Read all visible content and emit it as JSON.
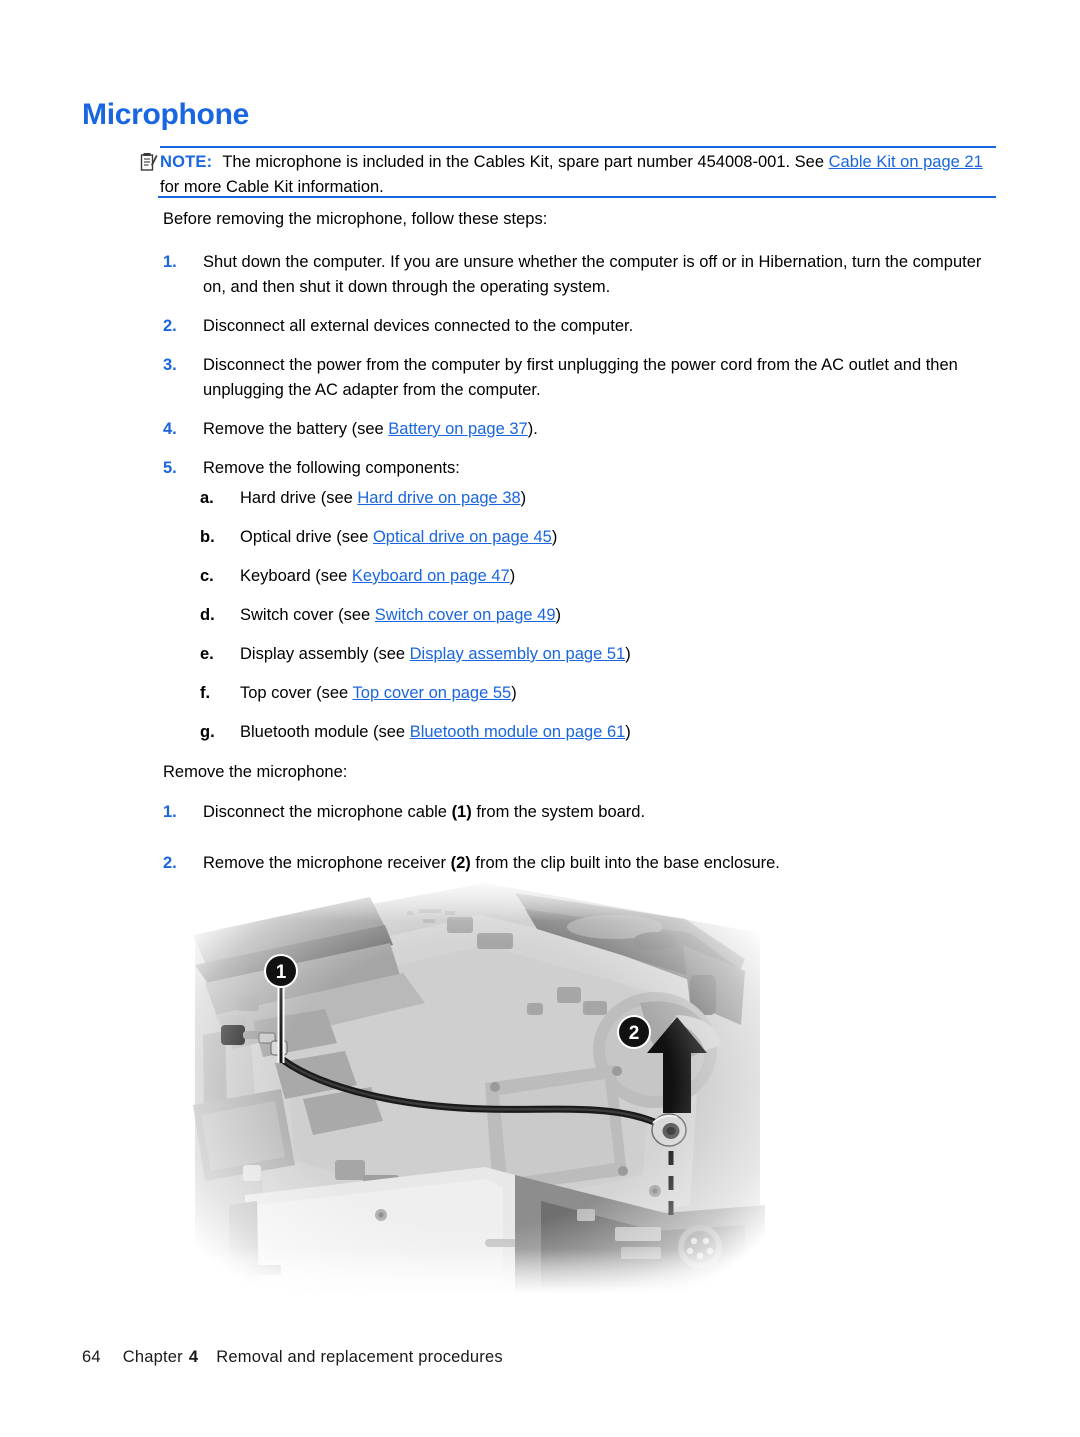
{
  "document": {
    "heading": "Microphone",
    "colors": {
      "accent_blue": "#1a66e0",
      "text_black": "#000000",
      "link_blue": "#1a66e0"
    }
  },
  "note": {
    "icon": "note-clipboard-icon",
    "label": "NOTE:",
    "text_before_link": "The microphone is included in the Cables Kit, spare part number 454008-001. See ",
    "link": "Cable Kit on page 21",
    "text_after_link": " for more Cable Kit information."
  },
  "intro_paragraph": "Before removing the microphone, follow these steps:",
  "steps": [
    {
      "marker": "1.",
      "text": "Shut down the computer. If you are unsure whether the computer is off or in Hibernation, turn the computer on, and then shut it down through the operating system."
    },
    {
      "marker": "2.",
      "text": "Disconnect all external devices connected to the computer."
    },
    {
      "marker": "3.",
      "text": "Disconnect the power from the computer by first unplugging the power cord from the AC outlet and then unplugging the AC adapter from the computer."
    },
    {
      "marker": "4.",
      "text_before_link": "Remove the battery (see ",
      "link": "Battery on page 37",
      "text_after_link": ")."
    },
    {
      "marker": "5.",
      "text": "Remove the following components:"
    }
  ],
  "substeps": [
    {
      "marker": "a.",
      "text_before_link": "Hard drive (see ",
      "link": "Hard drive on page 38",
      "text_after_link": ")"
    },
    {
      "marker": "b.",
      "text_before_link": "Optical drive (see ",
      "link": "Optical drive on page 45",
      "text_after_link": ")"
    },
    {
      "marker": "c.",
      "text_before_link": "Keyboard (see ",
      "link": "Keyboard on page 47",
      "text_after_link": ")"
    },
    {
      "marker": "d.",
      "text_before_link": "Switch cover (see ",
      "link": "Switch cover on page 49",
      "text_after_link": ")"
    },
    {
      "marker": "e.",
      "text_before_link": "Display assembly (see ",
      "link": "Display assembly on page 51",
      "text_after_link": ")"
    },
    {
      "marker": "f.",
      "text_before_link": "Top cover (see ",
      "link": "Top cover on page 55",
      "text_after_link": ")"
    },
    {
      "marker": "g.",
      "text_before_link": "Bluetooth module (see ",
      "link": "Bluetooth module on page 61",
      "text_after_link": ")"
    }
  ],
  "mid_paragraph": "Remove the microphone:",
  "removal_steps": [
    {
      "marker": "1.",
      "text_before_callout": "Disconnect the microphone cable ",
      "callout": "(1)",
      "text_after_callout": " from the system board."
    },
    {
      "marker": "2.",
      "text_before_callout": "Remove the microphone receiver ",
      "callout": "(2)",
      "text_after_callout": " from the clip built into the base enclosure."
    }
  ],
  "figure": {
    "description": "Grayscale photograph of laptop base enclosure showing microphone cable routing",
    "callouts": [
      {
        "number": "1",
        "meaning": "microphone cable connector on system board"
      },
      {
        "number": "2",
        "meaning": "microphone receiver in base enclosure clip"
      }
    ]
  },
  "footer": {
    "page_number": "64",
    "chapter_word": "Chapter",
    "chapter_number": "4",
    "chapter_title": "Removal and replacement procedures"
  }
}
